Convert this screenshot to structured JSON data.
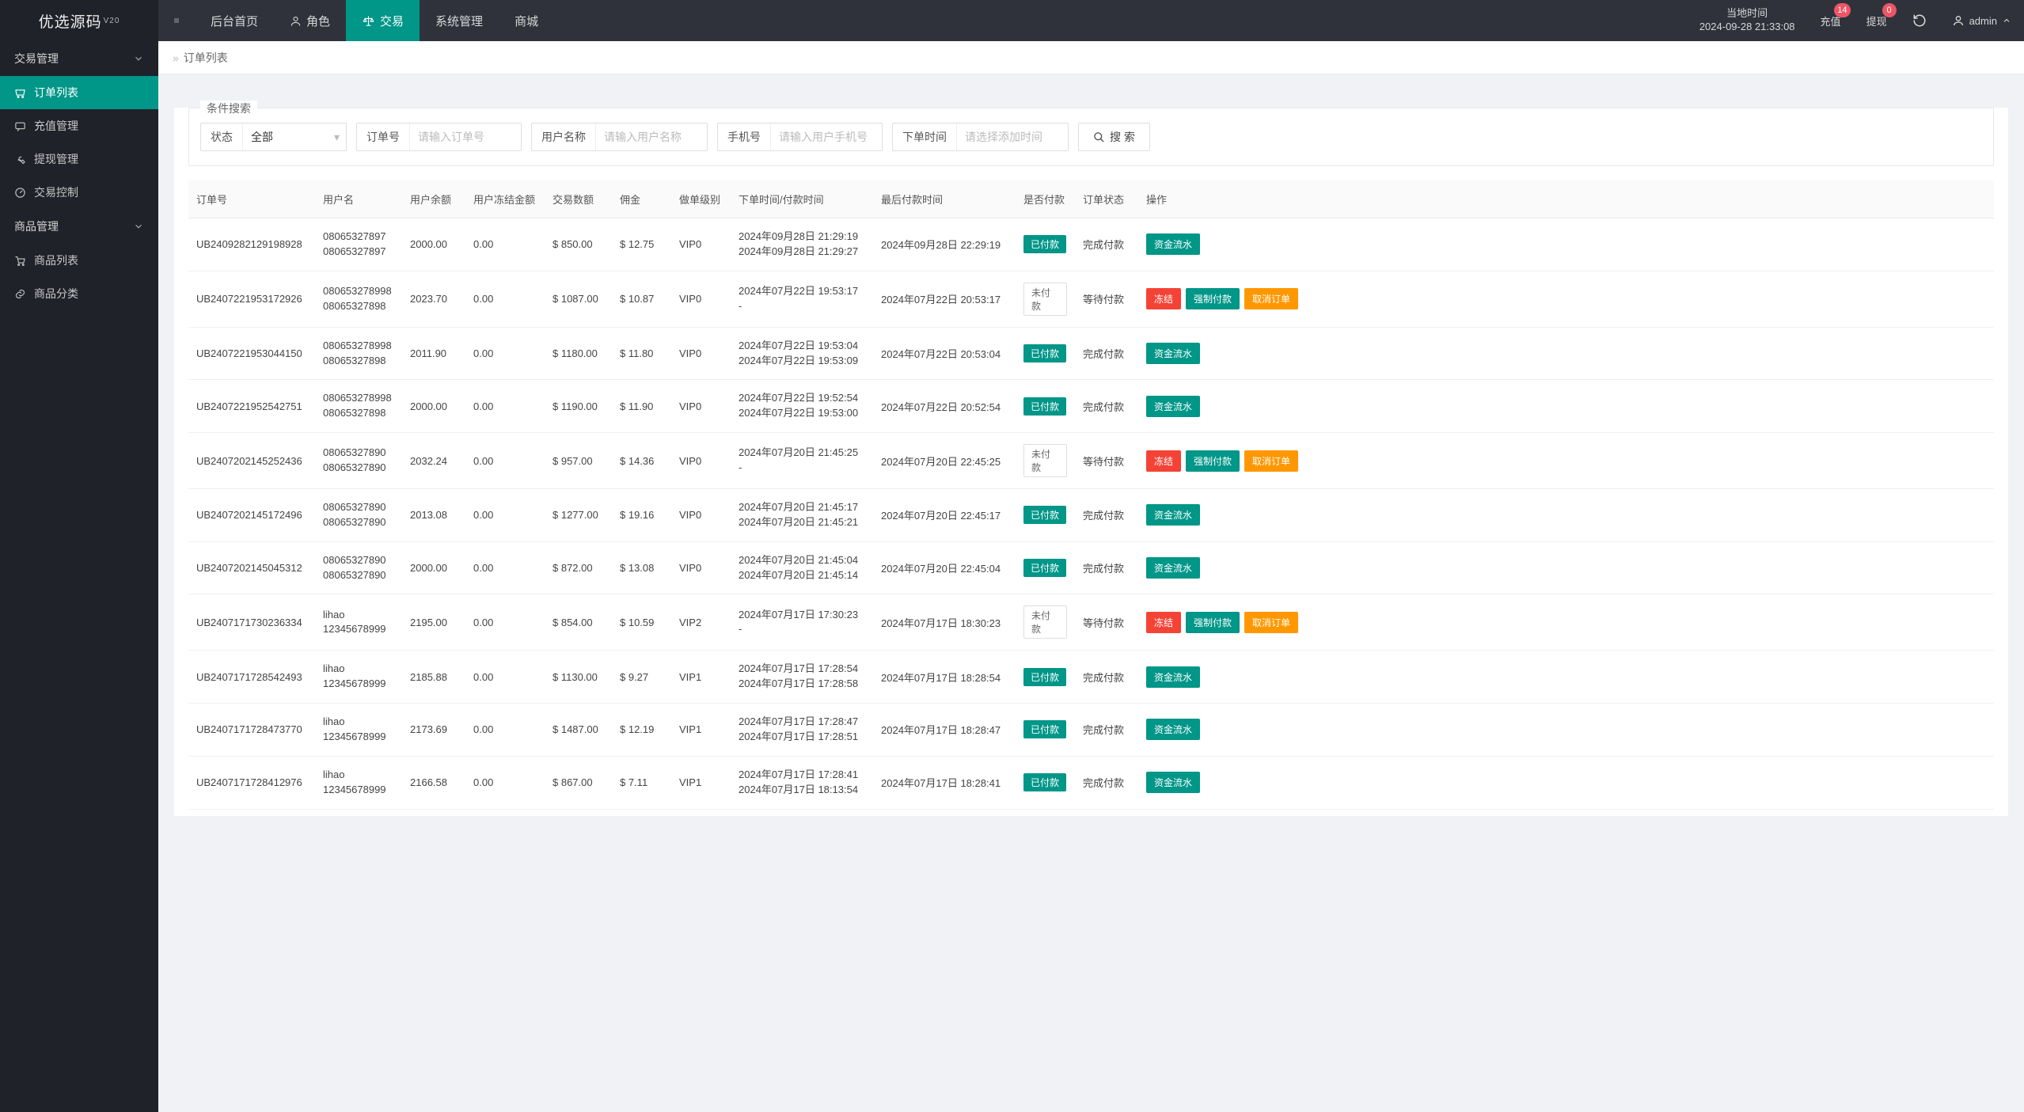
{
  "brand": {
    "name": "优选源码",
    "version": "V20"
  },
  "topnav": {
    "items": [
      {
        "label": "后台首页"
      },
      {
        "label": "角色",
        "icon": "user"
      },
      {
        "label": "交易",
        "icon": "scale",
        "active": true
      },
      {
        "label": "系统管理"
      },
      {
        "label": "商城"
      }
    ],
    "clock_title": "当地时间",
    "clock_value": "2024-09-28 21:33:08",
    "recharge_label": "充值",
    "recharge_badge": "14",
    "withdraw_label": "提现",
    "withdraw_badge": "0",
    "user_label": "admin"
  },
  "sidebar": {
    "sections": [
      {
        "title": "交易管理",
        "items": [
          {
            "label": "订单列表",
            "icon": "cart",
            "active": true
          },
          {
            "label": "充值管理",
            "icon": "message"
          },
          {
            "label": "提现管理",
            "icon": "wrench"
          },
          {
            "label": "交易控制",
            "icon": "gauge"
          }
        ]
      },
      {
        "title": "商品管理",
        "items": [
          {
            "label": "商品列表",
            "icon": "cart2"
          },
          {
            "label": "商品分类",
            "icon": "link"
          }
        ]
      }
    ]
  },
  "breadcrumb": {
    "current": "订单列表"
  },
  "filters": {
    "legend": "条件搜索",
    "status_label": "状态",
    "status_value": "全部",
    "orderno_label": "订单号",
    "orderno_ph": "请输入订单号",
    "username_label": "用户名称",
    "username_ph": "请输入用户名称",
    "phone_label": "手机号",
    "phone_ph": "请输入用户手机号",
    "ordertime_label": "下单时间",
    "ordertime_ph": "请选择添加时间",
    "search_label": "搜 索"
  },
  "table": {
    "cols": [
      "订单号",
      "用户名",
      "用户余额",
      "用户冻结金额",
      "交易数额",
      "佣金",
      "做单级别",
      "下单时间/付款时间",
      "最后付款时间",
      "是否付款",
      "订单状态",
      "操作"
    ],
    "btn_flow": "资金流水",
    "btn_freeze": "冻结",
    "btn_force": "强制付款",
    "btn_cancel": "取消订单",
    "status_paid_pill": "已付款",
    "status_unpaid_pill": "未付款",
    "status_done": "完成付款",
    "status_wait": "等待付款",
    "rows": [
      {
        "order": "UB2409282129198928",
        "uname1": "08065327897",
        "uname2": "08065327897",
        "bal": "2000.00",
        "fz": "0.00",
        "amt": "$ 850.00",
        "com": "$ 12.75",
        "lvl": "VIP0",
        "t1": "2024年09月28日 21:29:19",
        "t2": "2024年09月28日 21:29:27",
        "last": "2024年09月28日 22:29:19",
        "paid": true
      },
      {
        "order": "UB2407221953172926",
        "uname1": "080653278998",
        "uname2": "08065327898",
        "bal": "2023.70",
        "fz": "0.00",
        "amt": "$ 1087.00",
        "com": "$ 10.87",
        "lvl": "VIP0",
        "t1": "2024年07月22日 19:53:17",
        "t2": "-",
        "last": "2024年07月22日 20:53:17",
        "paid": false
      },
      {
        "order": "UB2407221953044150",
        "uname1": "080653278998",
        "uname2": "08065327898",
        "bal": "2011.90",
        "fz": "0.00",
        "amt": "$ 1180.00",
        "com": "$ 11.80",
        "lvl": "VIP0",
        "t1": "2024年07月22日 19:53:04",
        "t2": "2024年07月22日 19:53:09",
        "last": "2024年07月22日 20:53:04",
        "paid": true
      },
      {
        "order": "UB2407221952542751",
        "uname1": "080653278998",
        "uname2": "08065327898",
        "bal": "2000.00",
        "fz": "0.00",
        "amt": "$ 1190.00",
        "com": "$ 11.90",
        "lvl": "VIP0",
        "t1": "2024年07月22日 19:52:54",
        "t2": "2024年07月22日 19:53:00",
        "last": "2024年07月22日 20:52:54",
        "paid": true
      },
      {
        "order": "UB2407202145252436",
        "uname1": "08065327890",
        "uname2": "08065327890",
        "bal": "2032.24",
        "fz": "0.00",
        "amt": "$ 957.00",
        "com": "$ 14.36",
        "lvl": "VIP0",
        "t1": "2024年07月20日 21:45:25",
        "t2": "-",
        "last": "2024年07月20日 22:45:25",
        "paid": false
      },
      {
        "order": "UB2407202145172496",
        "uname1": "08065327890",
        "uname2": "08065327890",
        "bal": "2013.08",
        "fz": "0.00",
        "amt": "$ 1277.00",
        "com": "$ 19.16",
        "lvl": "VIP0",
        "t1": "2024年07月20日 21:45:17",
        "t2": "2024年07月20日 21:45:21",
        "last": "2024年07月20日 22:45:17",
        "paid": true
      },
      {
        "order": "UB2407202145045312",
        "uname1": "08065327890",
        "uname2": "08065327890",
        "bal": "2000.00",
        "fz": "0.00",
        "amt": "$ 872.00",
        "com": "$ 13.08",
        "lvl": "VIP0",
        "t1": "2024年07月20日 21:45:04",
        "t2": "2024年07月20日 21:45:14",
        "last": "2024年07月20日 22:45:04",
        "paid": true
      },
      {
        "order": "UB2407171730236334",
        "uname1": "lihao",
        "uname2": "12345678999",
        "bal": "2195.00",
        "fz": "0.00",
        "amt": "$ 854.00",
        "com": "$ 10.59",
        "lvl": "VIP2",
        "t1": "2024年07月17日 17:30:23",
        "t2": "-",
        "last": "2024年07月17日 18:30:23",
        "paid": false
      },
      {
        "order": "UB2407171728542493",
        "uname1": "lihao",
        "uname2": "12345678999",
        "bal": "2185.88",
        "fz": "0.00",
        "amt": "$ 1130.00",
        "com": "$ 9.27",
        "lvl": "VIP1",
        "t1": "2024年07月17日 17:28:54",
        "t2": "2024年07月17日 17:28:58",
        "last": "2024年07月17日 18:28:54",
        "paid": true
      },
      {
        "order": "UB2407171728473770",
        "uname1": "lihao",
        "uname2": "12345678999",
        "bal": "2173.69",
        "fz": "0.00",
        "amt": "$ 1487.00",
        "com": "$ 12.19",
        "lvl": "VIP1",
        "t1": "2024年07月17日 17:28:47",
        "t2": "2024年07月17日 17:28:51",
        "last": "2024年07月17日 18:28:47",
        "paid": true
      },
      {
        "order": "UB2407171728412976",
        "uname1": "lihao",
        "uname2": "12345678999",
        "bal": "2166.58",
        "fz": "0.00",
        "amt": "$ 867.00",
        "com": "$ 7.11",
        "lvl": "VIP1",
        "t1": "2024年07月17日 17:28:41",
        "t2": "2024年07月17日 18:13:54",
        "last": "2024年07月17日 18:28:41",
        "paid": true
      }
    ]
  }
}
